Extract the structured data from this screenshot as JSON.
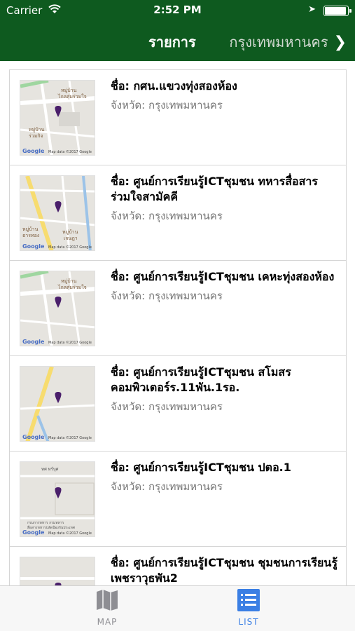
{
  "status_bar": {
    "carrier": "Carrier",
    "time": "2:52 PM"
  },
  "nav": {
    "title": "รายการ",
    "right_label": "กรุงเทพมหานคร"
  },
  "items": [
    {
      "name": "ชื่อ: กศน.แขวงทุ่งสองห้อง",
      "province": "จังหวัด: กรุงเทพมหานคร"
    },
    {
      "name": "ชื่อ: ศูนย์การเรียนรู้ICTชุมชน ทหารสื่อสารร่วมใจสามัคคี",
      "province": "จังหวัด: กรุงเทพมหานคร"
    },
    {
      "name": "ชื่อ: ศูนย์การเรียนรู้ICTชุมชน เคหะทุ่งสองห้อง",
      "province": "จังหวัด: กรุงเทพมหานคร"
    },
    {
      "name": "ชื่อ: ศูนย์การเรียนรู้ICTชุมชน สโมสรคอมพิวเตอร์ร.11พัน.1รอ.",
      "province": "จังหวัด: กรุงเทพมหานคร"
    },
    {
      "name": "ชื่อ: ศูนย์การเรียนรู้ICTชุมชน ปตอ.1",
      "province": "จังหวัด: กรุงเทพมหานคร"
    },
    {
      "name": "ชื่อ: ศูนย์การเรียนรู้ICTชุมชน ชุมชนการเรียนรู้เพชราวุธพัน2",
      "province": ""
    }
  ],
  "map_labels": {
    "google": "Google",
    "map_data": "Map data ©2017 Google",
    "m1_a": "หมู่บ้าน",
    "m1_b": "ไกลสุ่มร่วมใจ",
    "m1_c": "หมู่บ้าน",
    "m1_d": "ร่วมกิจ",
    "m2_a": "หมู่บ้าน",
    "m2_b": "ธารทอง",
    "m2_c": "หมู่บ้าน",
    "m2_d": "เจษฎา",
    "m5_a": "ทศ ทร์บุศ",
    "m5_b": "กรมการทหาร กรมทหาร",
    "m5_c": "สื่อสารทหารปลัดป้องกันประเทศ"
  },
  "tabs": {
    "map_label": "MAP",
    "list_label": "LIST"
  },
  "colors": {
    "nav_bg": "#0e5a1f",
    "tab_active": "#3b7fe4",
    "tab_inactive": "#8e8e93",
    "pin": "#4a1f6b"
  },
  "battery_level": 0.95
}
